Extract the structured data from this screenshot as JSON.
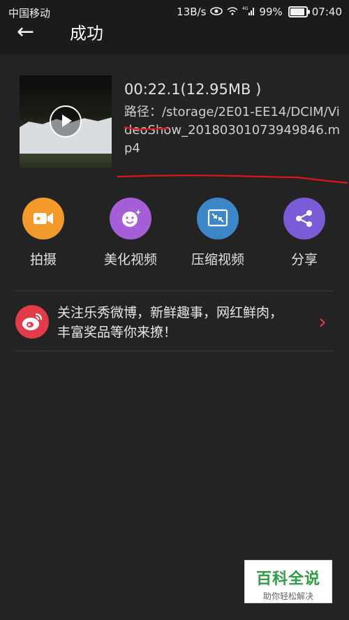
{
  "status_bar": {
    "carrier": "中国移动",
    "speed": "13B/s",
    "battery": "99%",
    "battery_level": 0.99,
    "time": "07:40",
    "network": "4G"
  },
  "header": {
    "title": "成功"
  },
  "video": {
    "duration_size": "00:22.1(12.95MB )",
    "path": "路径：/storage/2E01-EE14/DCIM/VideoShow_20180301073949846.mp4"
  },
  "actions": [
    {
      "label": "拍摄",
      "icon": "video-camera-icon",
      "color": "#f39a2c"
    },
    {
      "label": "美化视频",
      "icon": "sticker-smile-icon",
      "color": "#a45ed6"
    },
    {
      "label": "压缩视频",
      "icon": "compress-icon",
      "color": "#3b87c8"
    },
    {
      "label": "分享",
      "icon": "share-icon",
      "color": "#7a5cd6"
    }
  ],
  "weibo": {
    "text": "关注乐秀微博，新鲜趣事，网红鲜肉，丰富奖品等你来撩！",
    "icon": "weibo-icon",
    "color": "#e23c4a"
  },
  "watermark": {
    "main": "百科全说",
    "sub": "助你轻松解决"
  }
}
